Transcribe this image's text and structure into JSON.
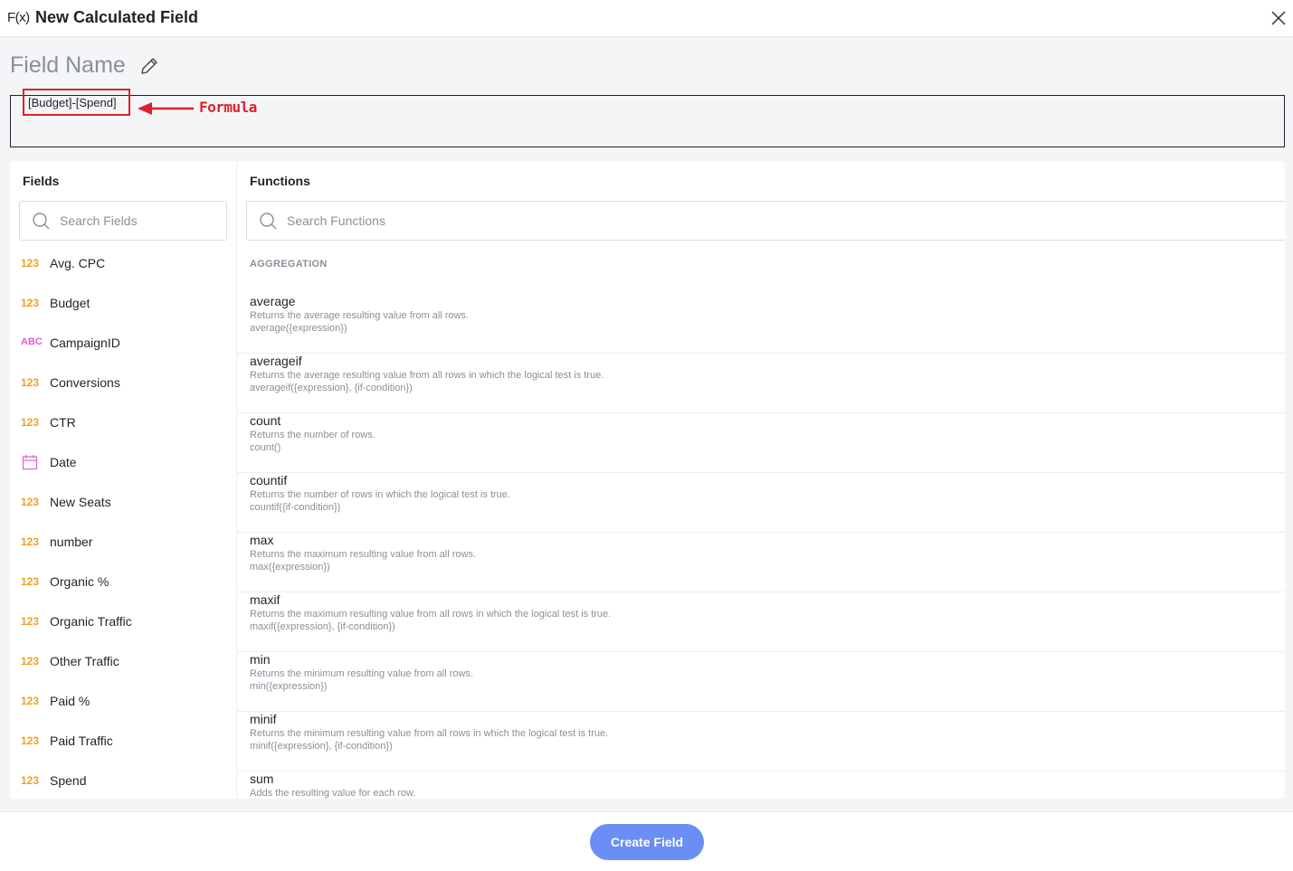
{
  "header": {
    "fx_label": "F(x)",
    "title": "New Calculated Field",
    "close_icon": "close-icon"
  },
  "field_name": {
    "label": "Field Name",
    "edit_icon": "pencil-icon"
  },
  "formula": {
    "value": "[Budget]-[Spend]",
    "annotation": "Formula",
    "annotation_color": "#e0202a"
  },
  "fields_panel": {
    "title": "Fields",
    "search_placeholder": "Search Fields",
    "items": [
      {
        "type_label": "123",
        "type": "number",
        "label": "Avg. CPC"
      },
      {
        "type_label": "123",
        "type": "number",
        "label": "Budget"
      },
      {
        "type_label": "ABC",
        "type": "text",
        "label": "CampaignID"
      },
      {
        "type_label": "123",
        "type": "number",
        "label": "Conversions"
      },
      {
        "type_label": "123",
        "type": "number",
        "label": "CTR"
      },
      {
        "type_label": "",
        "type": "date",
        "label": "Date"
      },
      {
        "type_label": "123",
        "type": "number",
        "label": "New Seats"
      },
      {
        "type_label": "123",
        "type": "number",
        "label": "number"
      },
      {
        "type_label": "123",
        "type": "number",
        "label": "Organic %"
      },
      {
        "type_label": "123",
        "type": "number",
        "label": "Organic Traffic"
      },
      {
        "type_label": "123",
        "type": "number",
        "label": "Other Traffic"
      },
      {
        "type_label": "123",
        "type": "number",
        "label": "Paid %"
      },
      {
        "type_label": "123",
        "type": "number",
        "label": "Paid Traffic"
      },
      {
        "type_label": "123",
        "type": "number",
        "label": "Spend"
      }
    ]
  },
  "functions_panel": {
    "title": "Functions",
    "search_placeholder": "Search Functions",
    "section": "AGGREGATION",
    "items": [
      {
        "name": "average",
        "desc": "Returns the average resulting value from all rows.",
        "sig": "average({expression})"
      },
      {
        "name": "averageif",
        "desc": "Returns the average resulting value from all rows in which the logical test is true.",
        "sig": "averageif({expression}, {if-condition})"
      },
      {
        "name": "count",
        "desc": "Returns the number of rows.",
        "sig": "count()"
      },
      {
        "name": "countif",
        "desc": "Returns the number of rows in which the logical test is true.",
        "sig": "countif({if-condition})"
      },
      {
        "name": "max",
        "desc": "Returns the maximum resulting value from all rows.",
        "sig": "max({expression})"
      },
      {
        "name": "maxif",
        "desc": "Returns the maximum resulting value from all rows in which the logical test is true.",
        "sig": "maxif({expression}, {if-condition})"
      },
      {
        "name": "min",
        "desc": "Returns the minimum resulting value from all rows.",
        "sig": "min({expression})"
      },
      {
        "name": "minif",
        "desc": "Returns the minimum resulting value from all rows in which the logical test is true.",
        "sig": "minif({expression}, {if-condition})"
      },
      {
        "name": "sum",
        "desc": "Adds the resulting value for each row.",
        "sig": ""
      }
    ]
  },
  "footer": {
    "create_label": "Create Field",
    "button_color": "#6b8ef5"
  }
}
